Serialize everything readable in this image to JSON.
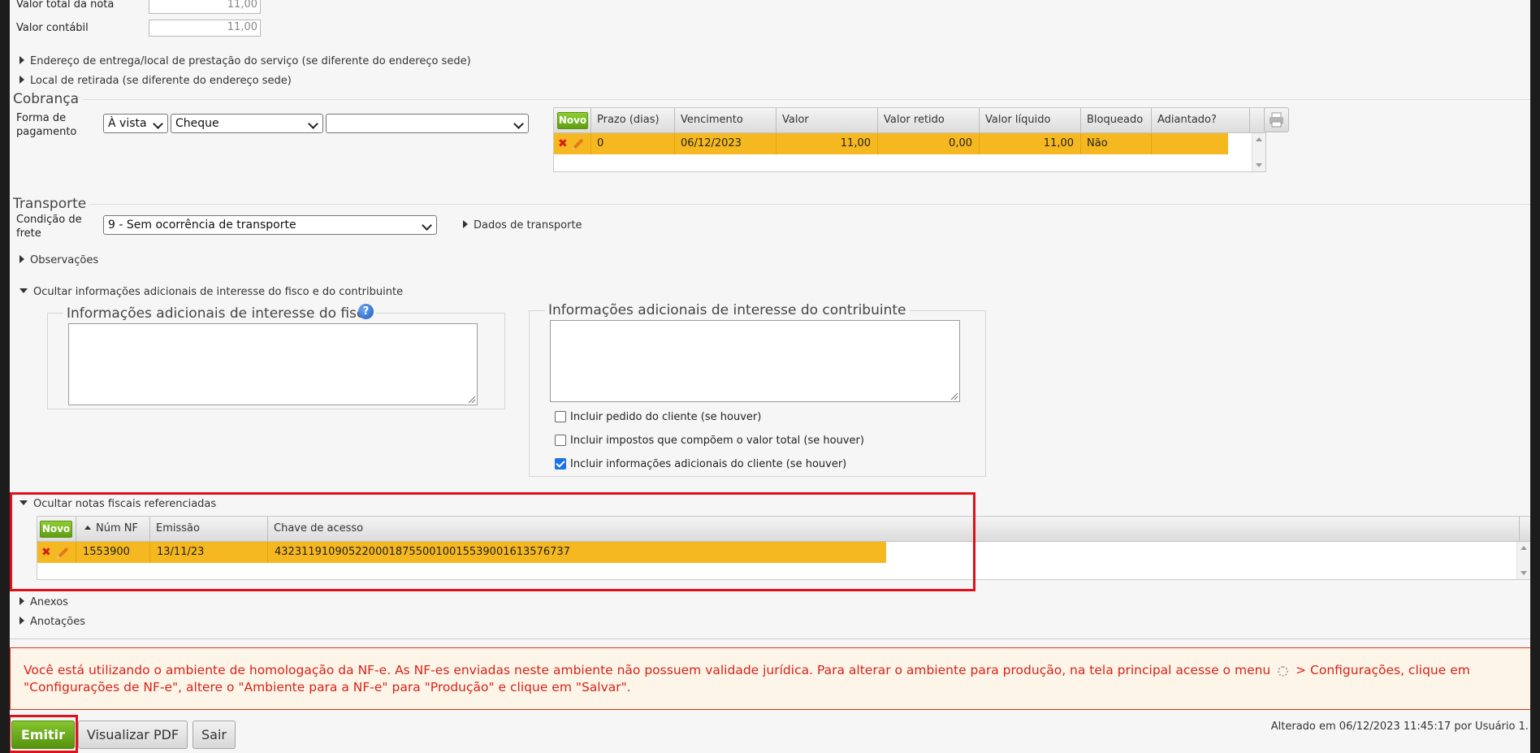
{
  "totals": {
    "valor_total_label": "Valor total da nota",
    "valor_total_value": "11,00",
    "valor_contabil_label": "Valor contábil",
    "valor_contabil_value": "11,00"
  },
  "sections": {
    "endereco_entrega": "Endereço de entrega/local de prestação do serviço (se diferente do endereço sede)",
    "local_retirada": "Local de retirada (se diferente do endereço sede)"
  },
  "cobranca": {
    "legend": "Cobrança",
    "forma_label": "Forma de pagamento",
    "select_prazo": "À vista",
    "select_tipo": "Cheque",
    "select_extra": "",
    "novo_label": "Novo",
    "columns": [
      "Prazo (dias)",
      "Vencimento",
      "Valor",
      "Valor retido",
      "Valor líquido",
      "Bloqueado",
      "Adiantado?"
    ],
    "rows": [
      {
        "prazo": "0",
        "vencimento": "06/12/2023",
        "valor": "11,00",
        "retido": "0,00",
        "liquido": "11,00",
        "bloqueado": "Não",
        "adiantado": ""
      }
    ]
  },
  "transporte": {
    "legend": "Transporte",
    "condicao_label": "Condição de frete",
    "condicao_value": "9 - Sem ocorrência de transporte",
    "dados_link": "Dados de transporte"
  },
  "observacoes": "Observações",
  "info_adicionais": {
    "toggle": "Ocultar informações adicionais de interesse do fisco e do contribuinte",
    "fisco_legend": "Informações adicionais de interesse do fisco",
    "fisco_help": "?",
    "contribuinte_legend": "Informações adicionais de interesse do contribuinte",
    "checkboxes": [
      {
        "label": "Incluir pedido do cliente (se houver)",
        "checked": false
      },
      {
        "label": "Incluir impostos que compõem o valor total (se houver)",
        "checked": false
      },
      {
        "label": "Incluir informações adicionais do cliente (se houver)",
        "checked": true
      }
    ]
  },
  "referenciadas": {
    "toggle": "Ocultar notas fiscais referenciadas",
    "novo_label": "Novo",
    "columns": [
      "Núm NF",
      "Emissão",
      "Chave de acesso"
    ],
    "rows": [
      {
        "num": "1553900",
        "emissao": "13/11/23",
        "chave": "43231191090522000187550010015539001613576737"
      }
    ]
  },
  "anexos": "Anexos",
  "anotacoes": "Anotações",
  "warning": {
    "part1": "Você está utilizando o ambiente de homologação da NF-e. As NF-es enviadas neste ambiente não possuem validade jurídica. Para alterar o ambiente para produção, na tela principal acesse o menu",
    "part2": "> Configurações, clique em \"Configurações de NF-e\", altere o \"Ambiente para a NF-e\" para \"Produção\" e clique em \"Salvar\"."
  },
  "buttons": {
    "emitir": "Emitir",
    "visualizar_pdf": "Visualizar PDF",
    "sair": "Sair"
  },
  "footer_status": "Alterado em 06/12/2023 11:45:17 por Usuário 1.",
  "colors": {
    "row_highlight": "#f5b821",
    "novo_green": "#6fae1c",
    "warning_red": "#d8221a",
    "annotation_red": "#e0101a"
  }
}
